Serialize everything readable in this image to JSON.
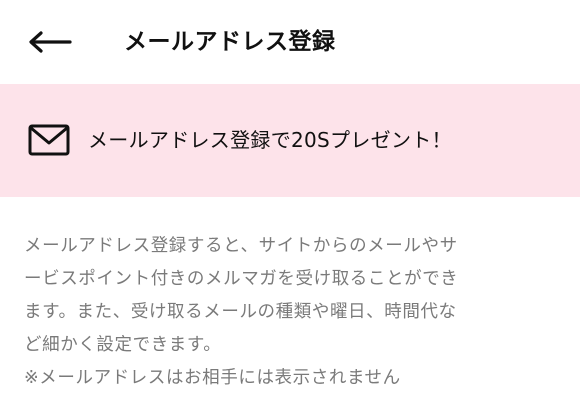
{
  "header": {
    "title": "メールアドレス登録",
    "back_icon": "arrow-left-icon"
  },
  "promo": {
    "icon": "mail-icon",
    "text": "メールアドレス登録で20Sプレゼント！",
    "background_color": "#fde3ea"
  },
  "description": {
    "lines": [
      "メールアドレス登録すると、サイトからのメールやサ",
      "ービスポイント付きのメルマガを受け取ることができ",
      "ます。また、受け取るメールの種類や曜日、時間代な",
      "ど細かく設定できます。"
    ],
    "note": "※メールアドレスはお相手には表示されません"
  }
}
